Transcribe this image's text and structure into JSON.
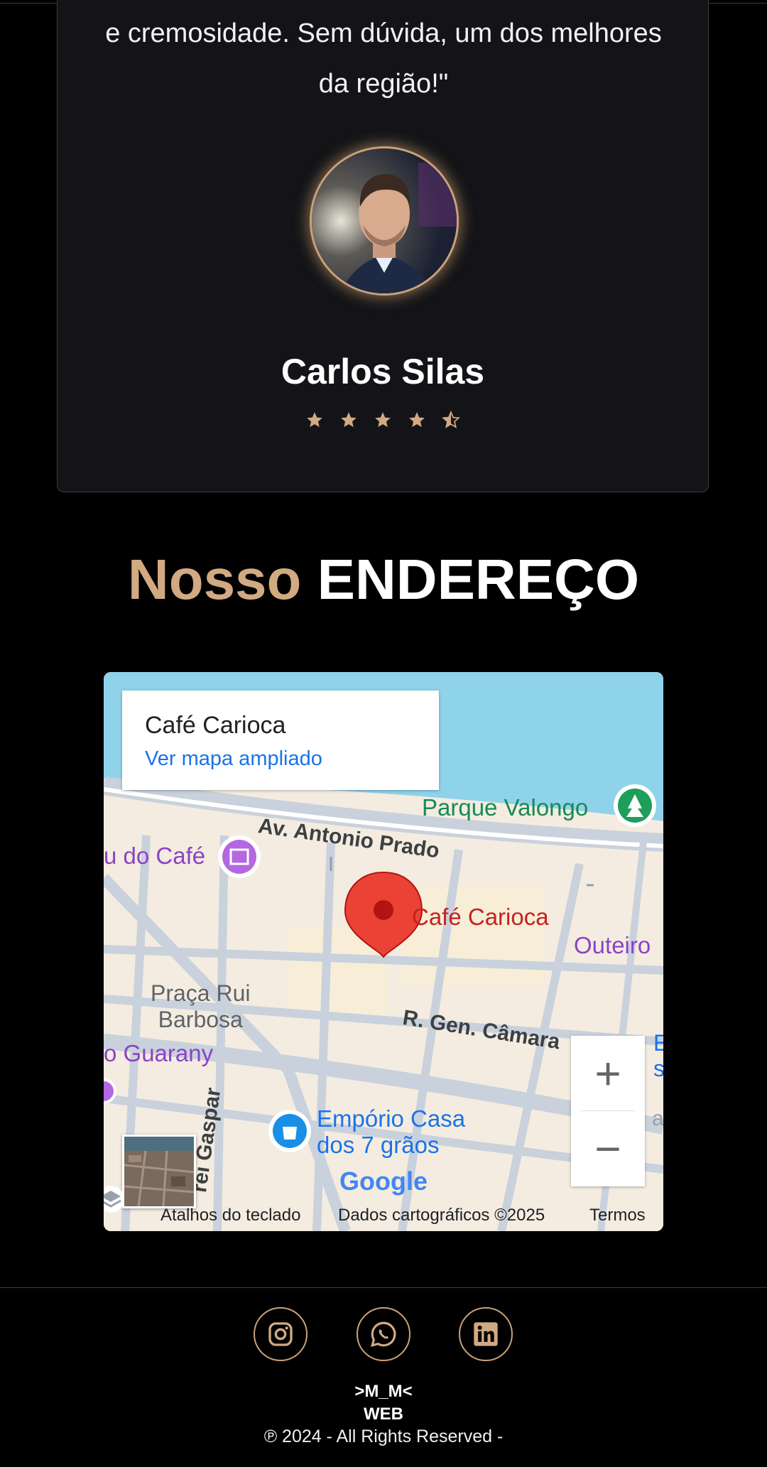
{
  "testimonial": {
    "quote_line1": "e cremosidade. Sem dúvida, um dos melhores",
    "quote_line2": "da região!\"",
    "author": "Carlos Silas",
    "rating": 4.5,
    "rating_max": 5
  },
  "address_section": {
    "title_accent": "Nosso",
    "title_main": "ENDEREÇO"
  },
  "map": {
    "place_name": "Café Carioca",
    "enlarge_link": "Ver mapa ampliado",
    "labels": {
      "park": "Parque Valongo",
      "avenue": "Av. Antonio Prado",
      "museum": "u do Café",
      "marker": "Café Carioca",
      "outeiro": "Outeiro",
      "praca_line1": "Praça Rui",
      "praca_line2": "Barbosa",
      "street": "R. Gen. Câmara",
      "guarany": "o Guarany",
      "gaspar": "rei Gaspar",
      "emporio_line1": "Empório Casa",
      "emporio_line2": "dos 7 grãos",
      "edge_b": "E",
      "edge_st": "st",
      "edge_at": "at"
    },
    "google_logo": "Google",
    "zoom_in": "+",
    "zoom_out": "−",
    "attribution": {
      "shortcuts": "Atalhos do teclado",
      "data": "Dados cartográficos ©2025",
      "terms": "Termos"
    }
  },
  "footer": {
    "social": [
      "instagram-icon",
      "whatsapp-icon",
      "linkedin-icon"
    ],
    "brand_line1": ">M_M<",
    "brand_line2": "WEB",
    "copyright": "℗ 2024 - All Rights Reserved -"
  },
  "colors": {
    "accent": "#d1aa82",
    "card_bg": "#141418",
    "map_link": "#1a73e8",
    "marker_red": "#ea4335"
  }
}
